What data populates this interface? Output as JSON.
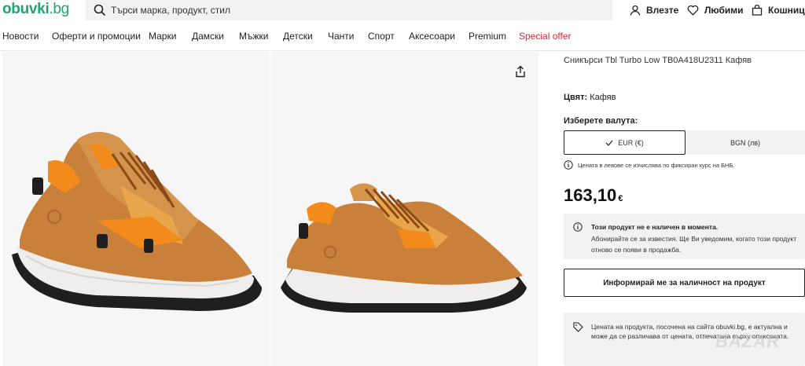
{
  "header": {
    "logo_main": "obuvki",
    "logo_tld": ".bg",
    "search_placeholder": "Търси марка, продукт, стил",
    "login": "Влезте",
    "favorites": "Любими",
    "cart": "Кошница"
  },
  "nav": [
    {
      "label": "Новости"
    },
    {
      "label": "Оферти и промоции"
    },
    {
      "label": "Марки"
    },
    {
      "label": "Дамски"
    },
    {
      "label": "Мъжки"
    },
    {
      "label": "Детски"
    },
    {
      "label": "Чанти"
    },
    {
      "label": "Спорт"
    },
    {
      "label": "Аксесоари"
    },
    {
      "label": "Premium"
    },
    {
      "label": "Special offer",
      "color": "#e0282e"
    }
  ],
  "product": {
    "name": "Сникърси Tbl Turbo Low TB0A418U2311 Кафяв",
    "color_label": "Цвят:",
    "color_value": "Кафяв",
    "currency_label": "Изберете валута:",
    "currency_eur": "EUR (€)",
    "currency_bgn": "BGN (лв)",
    "currency_note": "Цената в левове се изчислява по фиксиран курс на БНБ.",
    "price": "163,10",
    "price_currency": "€",
    "unavailable_title": "Този продукт не е наличен в момента.",
    "unavailable_text": "Абонирайте се за известия. Ще Ви уведомим, когато този продукт отново се появи в продажба.",
    "notify_button": "Информирай ме за наличност на продукт",
    "price_note": "Цената на продукта, посочена на сайта obuvki.bg, е актуална и може да се различава от цената, отпечатана върху опаковката."
  },
  "watermark": "BAZAR",
  "colors": {
    "brand": "#1fa56f",
    "special": "#e0282e",
    "shoe_tan": "#c9803a",
    "shoe_orange": "#f28a1c"
  }
}
